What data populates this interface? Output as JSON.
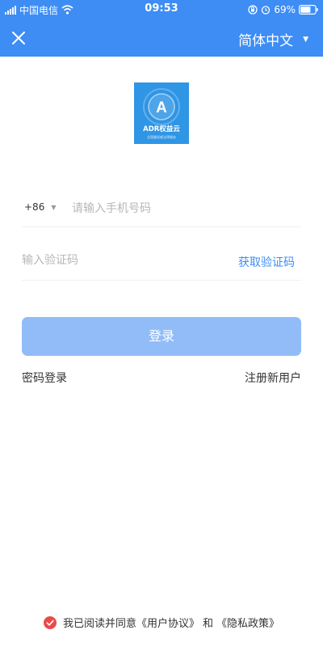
{
  "status_bar": {
    "carrier": "中国电信",
    "time": "09:53",
    "battery": "69%"
  },
  "nav": {
    "close_icon": "close-icon",
    "language": "简体中文"
  },
  "logo": {
    "name": "ADR权益云",
    "letter": "A",
    "subtitle": "全国最权威法律服务"
  },
  "phone": {
    "country_code": "+86",
    "placeholder": "请输入手机号码"
  },
  "code": {
    "placeholder": "输入验证码",
    "get_code_label": "获取验证码"
  },
  "login_label": "登录",
  "password_login_label": "密码登录",
  "register_label": "注册新用户",
  "agreement": {
    "prefix": "我已阅读并同意",
    "user_agreement": "《用户协议》",
    "and": "和",
    "privacy_policy": "《隐私政策》"
  },
  "colors": {
    "primary": "#3d8df5",
    "login_disabled": "#92bcf7",
    "logo_bg": "#2f95e5",
    "check_red": "#e94b4b"
  }
}
